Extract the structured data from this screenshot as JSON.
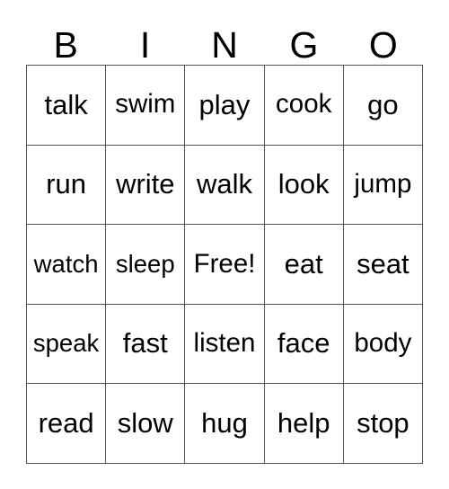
{
  "card": {
    "title": "BINGO",
    "header_letters": [
      "B",
      "I",
      "N",
      "G",
      "O"
    ],
    "columns": 5,
    "rows": 5,
    "free_space_label": "Free!",
    "free_space_position": {
      "row": 3,
      "column": 3
    },
    "text_color": "#000000",
    "grid_line_color": "#555555",
    "background_color": "#ffffff",
    "grid": [
      [
        "talk",
        "swim",
        "play",
        "cook",
        "go"
      ],
      [
        "run",
        "write",
        "walk",
        "look",
        "jump"
      ],
      [
        "watch",
        "sleep",
        "Free!",
        "eat",
        "seat"
      ],
      [
        "speak",
        "fast",
        "listen",
        "face",
        "body"
      ],
      [
        "read",
        "slow",
        "hug",
        "help",
        "stop"
      ]
    ]
  }
}
